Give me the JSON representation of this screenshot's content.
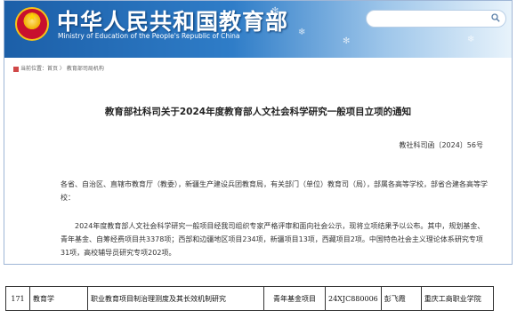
{
  "header": {
    "title_cn": "中华人民共和国教育部",
    "title_en": "Ministry of Education of the People's Republic of China",
    "search_placeholder": ""
  },
  "breadcrumb": {
    "text": "当前位置：首页 〉 教育部司局机构"
  },
  "article": {
    "title": "教育部社科司关于2024年度教育部人文社会科学研究一般项目立项的通知",
    "doc_number": "教社科司函〔2024〕56号",
    "para1": "各省、自治区、直辖市教育厅（教委），新疆生产建设兵团教育局，有关部门（单位）教育司（局），部属各高等学校，部省合建各高等学校：",
    "para2": "2024年度教育部人文社会科学研究一般项目经我司组织专家严格评审和面向社会公示，现将立项结果予以公布。其中，规划基金、青年基金、自筹经费项目共3378项；西部和边疆地区项目234项，新疆项目13项，西藏项目2项。中国特色社会主义理论体系研究专项31项，高校辅导员研究专项202项。"
  },
  "table_row": {
    "index": "171",
    "discipline": "教育学",
    "project": "职业教育项目制治理测度及其长效机制研究",
    "type": "青年基金项目",
    "code": "24XJC880006",
    "person": "彭飞霞",
    "institution": "重庆工商职业学院"
  },
  "colors": {
    "header_blue": "#1c5fa8",
    "border": "#9fb6d6"
  }
}
